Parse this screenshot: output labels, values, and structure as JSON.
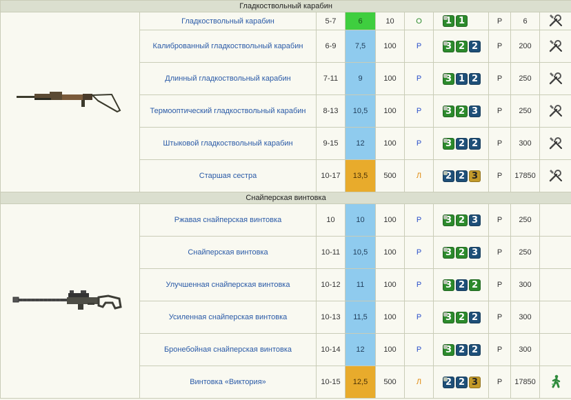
{
  "groups": [
    {
      "title": "Гладкоствольный карабин",
      "rows": [
        {
          "name": "Гладкоствольный карабин",
          "dmg": "5-7",
          "dps": "6",
          "dps_color": "green",
          "hp": "10",
          "rarity": "О",
          "rarity_class": "o",
          "m": [
            "1",
            "1"
          ],
          "mc": [
            "green",
            "green"
          ],
          "src": "Р",
          "price": "6",
          "icon": "tools"
        },
        {
          "name": "Калиброванный гладкоствольный карабин",
          "dmg": "6-9",
          "dps": "7,5",
          "dps_color": "blue",
          "hp": "100",
          "rarity": "Р",
          "rarity_class": "r",
          "m": [
            "3",
            "2",
            "2"
          ],
          "mc": [
            "green",
            "green",
            "navy"
          ],
          "src": "Р",
          "price": "200",
          "icon": "tools"
        },
        {
          "name": "Длинный гладкоствольный карабин",
          "dmg": "7-11",
          "dps": "9",
          "dps_color": "blue",
          "hp": "100",
          "rarity": "Р",
          "rarity_class": "r",
          "m": [
            "3",
            "1",
            "2"
          ],
          "mc": [
            "green",
            "navy",
            "navy"
          ],
          "src": "Р",
          "price": "250",
          "icon": "tools"
        },
        {
          "name": "Термооптический гладкоствольный карабин",
          "dmg": "8-13",
          "dps": "10,5",
          "dps_color": "blue",
          "hp": "100",
          "rarity": "Р",
          "rarity_class": "r",
          "m": [
            "3",
            "2",
            "3"
          ],
          "mc": [
            "green",
            "green",
            "navy"
          ],
          "src": "Р",
          "price": "250",
          "icon": "tools"
        },
        {
          "name": "Штыковой гладкоствольный карабин",
          "dmg": "9-15",
          "dps": "12",
          "dps_color": "blue",
          "hp": "100",
          "rarity": "Р",
          "rarity_class": "r",
          "m": [
            "3",
            "2",
            "2"
          ],
          "mc": [
            "green",
            "navy",
            "navy"
          ],
          "src": "Р",
          "price": "300",
          "icon": "tools"
        },
        {
          "name": "Старшая сестра",
          "dmg": "10-17",
          "dps": "13,5",
          "dps_color": "orange",
          "hp": "500",
          "rarity": "Л",
          "rarity_class": "l",
          "m": [
            "2",
            "2",
            "3"
          ],
          "mc": [
            "navy",
            "navy",
            "gold"
          ],
          "src": "Р",
          "price": "17850",
          "icon": "tools"
        }
      ]
    },
    {
      "title": "Снайперская винтовка",
      "rows": [
        {
          "name": "Ржавая снайперская винтовка",
          "dmg": "10",
          "dps": "10",
          "dps_color": "blue",
          "hp": "100",
          "rarity": "Р",
          "rarity_class": "r",
          "m": [
            "3",
            "2",
            "3"
          ],
          "mc": [
            "green",
            "green",
            "navy"
          ],
          "src": "Р",
          "price": "250",
          "icon": ""
        },
        {
          "name": "Снайперская винтовка",
          "dmg": "10-11",
          "dps": "10,5",
          "dps_color": "blue",
          "hp": "100",
          "rarity": "Р",
          "rarity_class": "r",
          "m": [
            "3",
            "2",
            "3"
          ],
          "mc": [
            "green",
            "green",
            "navy"
          ],
          "src": "Р",
          "price": "250",
          "icon": ""
        },
        {
          "name": "Улучшенная снайперская винтовка",
          "dmg": "10-12",
          "dps": "11",
          "dps_color": "blue",
          "hp": "100",
          "rarity": "Р",
          "rarity_class": "r",
          "m": [
            "3",
            "2",
            "2"
          ],
          "mc": [
            "green",
            "navy",
            "green"
          ],
          "src": "Р",
          "price": "300",
          "icon": ""
        },
        {
          "name": "Усиленная снайперская винтовка",
          "dmg": "10-13",
          "dps": "11,5",
          "dps_color": "blue",
          "hp": "100",
          "rarity": "Р",
          "rarity_class": "r",
          "m": [
            "3",
            "2",
            "2"
          ],
          "mc": [
            "green",
            "green",
            "navy"
          ],
          "src": "Р",
          "price": "300",
          "icon": ""
        },
        {
          "name": "Бронебойная снайперская винтовка",
          "dmg": "10-14",
          "dps": "12",
          "dps_color": "blue",
          "hp": "100",
          "rarity": "Р",
          "rarity_class": "r",
          "m": [
            "3",
            "2",
            "2"
          ],
          "mc": [
            "green",
            "navy",
            "navy"
          ],
          "src": "Р",
          "price": "300",
          "icon": ""
        },
        {
          "name": "Винтовка «Виктория»",
          "dmg": "10-15",
          "dps": "12,5",
          "dps_color": "orange",
          "hp": "500",
          "rarity": "Л",
          "rarity_class": "l",
          "m": [
            "2",
            "2",
            "3"
          ],
          "mc": [
            "navy",
            "navy",
            "gold"
          ],
          "src": "Р",
          "price": "17850",
          "icon": "person"
        }
      ]
    }
  ]
}
